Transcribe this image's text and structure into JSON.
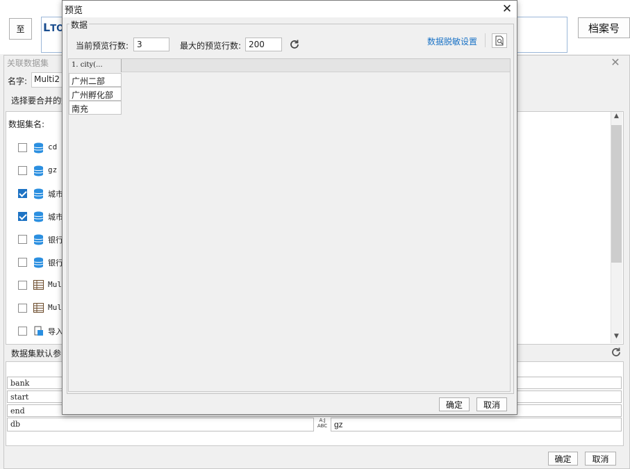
{
  "background": {
    "toolbar_left_button": "至",
    "logo_text": "TO",
    "toolbar_right_button": "档案号"
  },
  "relation_dialog": {
    "title": "关联数据集",
    "name_label": "名字:",
    "name_value": "Multi2",
    "merge_label": "选择要合并的数",
    "dataset_name_label": "数据集名:",
    "items": [
      {
        "label": "cd",
        "checked": false,
        "icon": "database-icon"
      },
      {
        "label": "gz",
        "checked": false,
        "icon": "database-icon"
      },
      {
        "label": "城市",
        "checked": true,
        "icon": "database-icon"
      },
      {
        "label": "城市",
        "checked": true,
        "icon": "database-icon"
      },
      {
        "label": "银行",
        "checked": false,
        "icon": "database-icon"
      },
      {
        "label": "银行",
        "checked": false,
        "icon": "database-icon"
      },
      {
        "label": "Mul",
        "checked": false,
        "icon": "table-icon"
      },
      {
        "label": "Mul",
        "checked": false,
        "icon": "table-icon"
      },
      {
        "label": "导入",
        "checked": false,
        "icon": "import-icon"
      }
    ],
    "params_label": "数据集默认参",
    "params": [
      {
        "name": "bank",
        "value": ""
      },
      {
        "name": "start",
        "value": ""
      },
      {
        "name": "end",
        "value": ""
      },
      {
        "name": "db",
        "value": "gz"
      }
    ],
    "ok_label": "确定",
    "cancel_label": "取消"
  },
  "preview_dialog": {
    "title": "预览",
    "group_label": "数据",
    "current_rows_label": "当前预览行数:",
    "current_rows_value": "3",
    "max_rows_label": "最大的预览行数:",
    "max_rows_value": "200",
    "desensitize_link": "数据脱敏设置",
    "column_header": "1. city(...",
    "rows": [
      "广州二部",
      "广州孵化部",
      "南充"
    ],
    "ok_label": "确定",
    "cancel_label": "取消"
  },
  "colors": {
    "accent": "#1e73c4",
    "link": "#1b73c6"
  }
}
